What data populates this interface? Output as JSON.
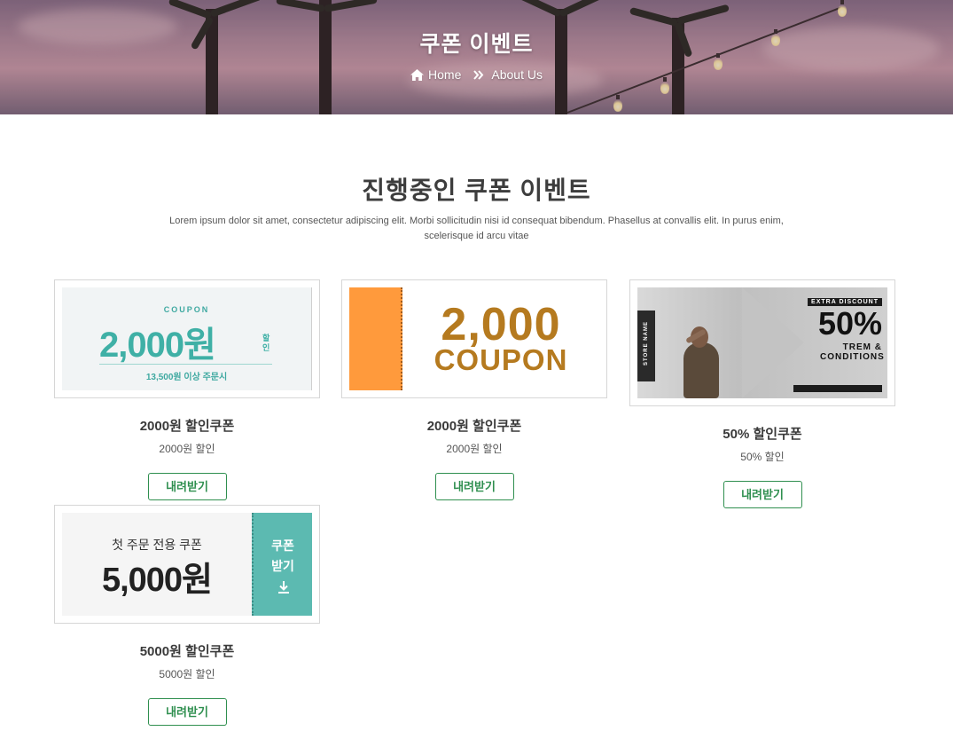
{
  "hero": {
    "title": "쿠폰 이벤트",
    "breadcrumb": {
      "home_label": "Home",
      "current_label": "About Us",
      "home_icon": "home-icon",
      "separator_icon": "double-chevron-right-icon"
    }
  },
  "section": {
    "title": "진행중인 쿠폰 이벤트",
    "description": "Lorem ipsum dolor sit amet, consectetur adipiscing elit. Morbi sollicitudin nisi id consequat bibendum. Phasellus at convallis elit. In purus enim, scelerisque id arcu vitae"
  },
  "colors": {
    "accent_green": "#2f8f4f",
    "coupon_teal": "#3fb0a6",
    "coupon_orange": "#ff9a3c",
    "coupon_gold": "#b57a1f"
  },
  "coupons": [
    {
      "name": "2000원 할인쿠폰",
      "sub": "2000원 할인",
      "button": "내려받기",
      "image": {
        "label": "COUPON",
        "amount": "2,000원",
        "halin": "할인",
        "condition": "13,500원 이상 주문시"
      }
    },
    {
      "name": "2000원 할인쿠폰",
      "sub": "2000원 할인",
      "button": "내려받기",
      "image": {
        "amount": "2,000",
        "word": "COUPON"
      }
    },
    {
      "name": "50% 할인쿠폰",
      "sub": "50% 할인",
      "button": "내려받기",
      "image": {
        "store": "STORE NAME",
        "extra": "EXTRA DISCOUNT",
        "percent": "50%",
        "terms": "TREM & CONDITIONS"
      }
    },
    {
      "name": "5000원 할인쿠폰",
      "sub": "5000원 할인",
      "button": "내려받기",
      "image": {
        "line1": "첫 주문 전용 쿠폰",
        "amount": "5,000원",
        "tab": "쿠폰\n받기",
        "tab_icon": "download-icon"
      }
    }
  ]
}
